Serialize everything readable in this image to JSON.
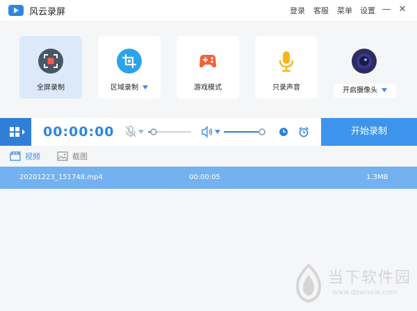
{
  "app": {
    "title": "风云录屏"
  },
  "title_menu": {
    "login": "登录",
    "service": "客服",
    "menu": "菜单",
    "settings": "设置"
  },
  "window_controls": {
    "minimize": "—",
    "close": "✕"
  },
  "modes": {
    "fullscreen": "全屏录制",
    "region": "区域录制",
    "game": "游戏模式",
    "audio_only": "只录声音",
    "camera": "开启摄像头"
  },
  "control": {
    "timer": "00:00:00",
    "mic_level": 0.05,
    "speaker_level": 1.0,
    "start_label": "开始录制"
  },
  "tabs": {
    "video": "视频",
    "screenshot": "截图"
  },
  "recordings": [
    {
      "name": "20201223_151748.mp4",
      "duration": "00:00:05",
      "size": "1.3MB"
    }
  ],
  "watermark": {
    "text": "当下软件园",
    "url": "www.downxia.com"
  },
  "colors": {
    "accent": "#3d94ec",
    "active_card": "#dbe9f9",
    "selected_row": "#73b1f0"
  }
}
